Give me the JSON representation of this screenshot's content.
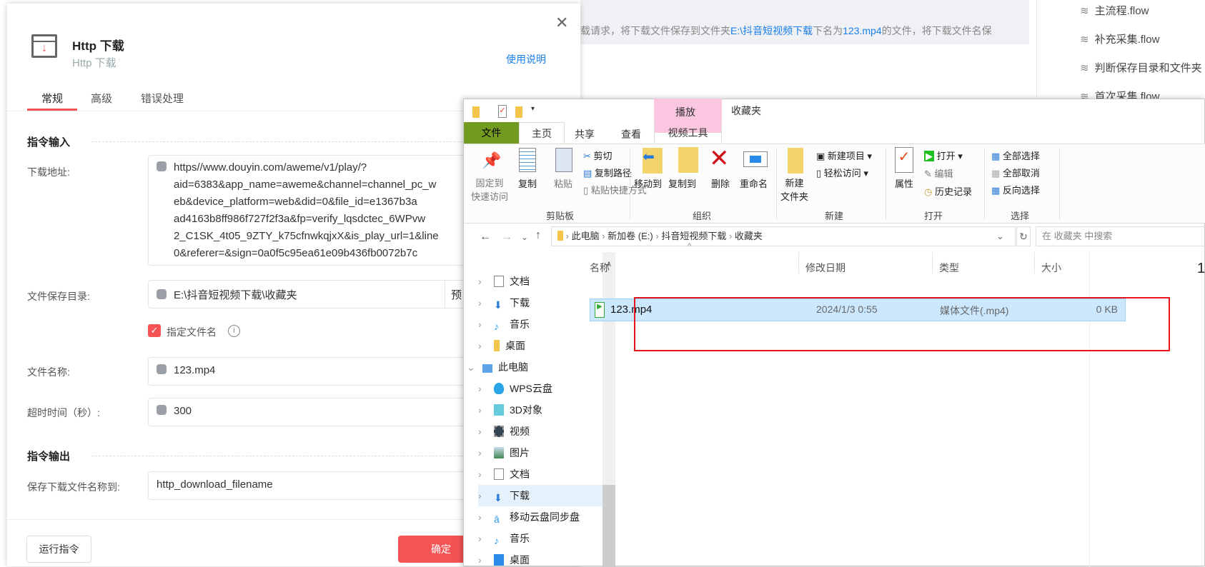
{
  "background": {
    "info_prefix": "载请求，将下载文件保存到文件夹",
    "info_path": "E:\\抖音短视频下载",
    "info_mid": "下名为",
    "info_file": "123.mp4",
    "info_suffix": "的文件，将下载文件名保",
    "flows": [
      "主流程.flow",
      "补充采集.flow",
      "判断保存目录和文件夹",
      "首次采集.flow"
    ]
  },
  "dialog": {
    "title": "Http 下载",
    "subtitle": "Http 下载",
    "help_link": "使用说明",
    "tabs": [
      "常规",
      "高级",
      "错误处理"
    ],
    "section_input": "指令输入",
    "section_output": "指令输出",
    "url_label": "下载地址:",
    "url_lines": [
      "https//www.douyin.com/aweme/v1/play/?",
      "aid=6383&app_name=aweme&channel=channel_pc_w",
      "eb&device_platform=web&did=0&file_id=e1367b3a",
      "ad4163b8ff986f727f2f3a&fp=verify_lqsdctec_6WPvw",
      "2_C1SK_4t05_9ZTY_k75cfnwkqjxX&is_play_url=1&line",
      "0&referer=&sign=0a0f5c95ea61e09b436fb0072b7c"
    ],
    "dir_label": "文件保存目录:",
    "dir_value": "E:\\抖音短视频下载\\收藏夹",
    "dir_button": "预",
    "checkbox_label": "指定文件名",
    "checkbox_checked": true,
    "filename_label": "文件名称:",
    "filename_value": "123.mp4",
    "timeout_label": "超时时间（秒）:",
    "timeout_value": "300",
    "output_label": "保存下载文件名称到:",
    "output_value": "http_download_filename",
    "run_button": "运行指令",
    "ok_button": "确定",
    "accent": "#f65454"
  },
  "explorer": {
    "context_tab": "播放",
    "window_title": "收藏夹",
    "tabs": [
      "文件",
      "主页",
      "共享",
      "查看",
      "视频工具"
    ],
    "clipboard": {
      "pin": "固定到\n快速访问",
      "copy": "复制",
      "paste": "粘贴",
      "cut": "剪切",
      "copy_path": "复制路径",
      "paste_shortcut": "粘贴快捷方式",
      "label": "剪贴板"
    },
    "organize": {
      "move": "移动到",
      "copyto": "复制到",
      "delete": "删除",
      "rename": "重命名",
      "label": "组织"
    },
    "new": {
      "folder": "新建\n文件夹",
      "item": "新建项目",
      "easy": "轻松访问",
      "label": "新建"
    },
    "open": {
      "props": "属性",
      "open": "打开",
      "edit": "编辑",
      "history": "历史记录",
      "label": "打开"
    },
    "select": {
      "all": "全部选择",
      "none": "全部取消",
      "invert": "反向选择",
      "label": "选择"
    },
    "breadcrumb": [
      "此电脑",
      "新加卷 (E:)",
      "抖音短视频下载",
      "收藏夹"
    ],
    "search_placeholder": "在 收藏夹 中搜索",
    "nav": [
      "文档",
      "下载",
      "音乐",
      "桌面",
      "此电脑",
      "WPS云盘",
      "3D对象",
      "视频",
      "图片",
      "文档",
      "下载",
      "移动云盘同步盘",
      "音乐",
      "桌面"
    ],
    "columns": [
      "名称",
      "修改日期",
      "类型",
      "大小"
    ],
    "file": {
      "name": "123.mp4",
      "date": "2024/1/3 0:55",
      "type": "媒体文件(.mp4)",
      "size": "0 KB"
    },
    "details_char": "1"
  }
}
